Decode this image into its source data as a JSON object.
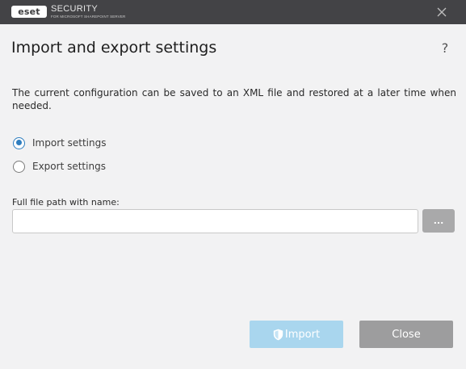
{
  "titlebar": {
    "logo_text": "eset",
    "product_name": "SECURITY",
    "product_sub": "FOR MICROSOFT SHAREPOINT SERVER",
    "close_icon": "close-icon",
    "background": "#434346"
  },
  "dialog": {
    "title": "Import and export settings",
    "help_label": "?",
    "description": "The current configuration can be saved to an XML file and restored at a later time when needed."
  },
  "options": [
    {
      "label": "Import settings",
      "selected": true
    },
    {
      "label": "Export settings",
      "selected": false
    }
  ],
  "file": {
    "label": "Full file path with name:",
    "value": "",
    "placeholder": "",
    "browse_label": "..."
  },
  "buttons": {
    "import_label": "Import",
    "import_icon": "shield-icon",
    "import_enabled": false,
    "close_label": "Close"
  },
  "colors": {
    "accent": "#2f7ebf",
    "import_disabled": "#a9d6ee",
    "close_button": "#9d9d9e",
    "browse_button": "#a9a9aa"
  }
}
